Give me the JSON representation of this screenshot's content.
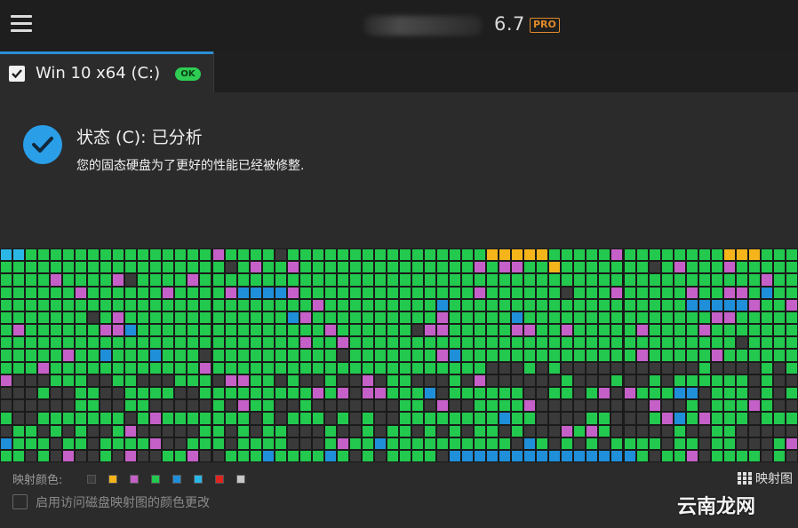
{
  "header": {
    "menu_icon": "hamburger-menu-icon",
    "version": "6.7",
    "pro_badge": "PRO"
  },
  "tab": {
    "label": "Win 10 x64 (C:)",
    "status_badge": "OK",
    "checked": true
  },
  "status": {
    "icon": "check-circle-icon",
    "title": "状态 (C): 已分析",
    "description": "您的固态硬盘为了更好的性能已经被修整."
  },
  "legend": {
    "label": "映射颜色:",
    "colors": [
      "#3a3a3a",
      "#f5b51a",
      "#c560c8",
      "#22c94e",
      "#1f8fd9",
      "#2bb7e6",
      "#e0251f",
      "#c8c8c8"
    ]
  },
  "map_button": {
    "label": "映射图",
    "icon": "grid-icon"
  },
  "option": {
    "label": "启用访问磁盘映射图的颜色更改",
    "checked": false
  },
  "watermark": "云南龙网",
  "colors": {
    "green": "#22c94e",
    "dark": "#3a3a3a",
    "purple": "#c560c8",
    "blue": "#1f8fd9",
    "cyan": "#2bb7e6",
    "yellow": "#f5b51a",
    "accent": "#2b8fd6"
  }
}
